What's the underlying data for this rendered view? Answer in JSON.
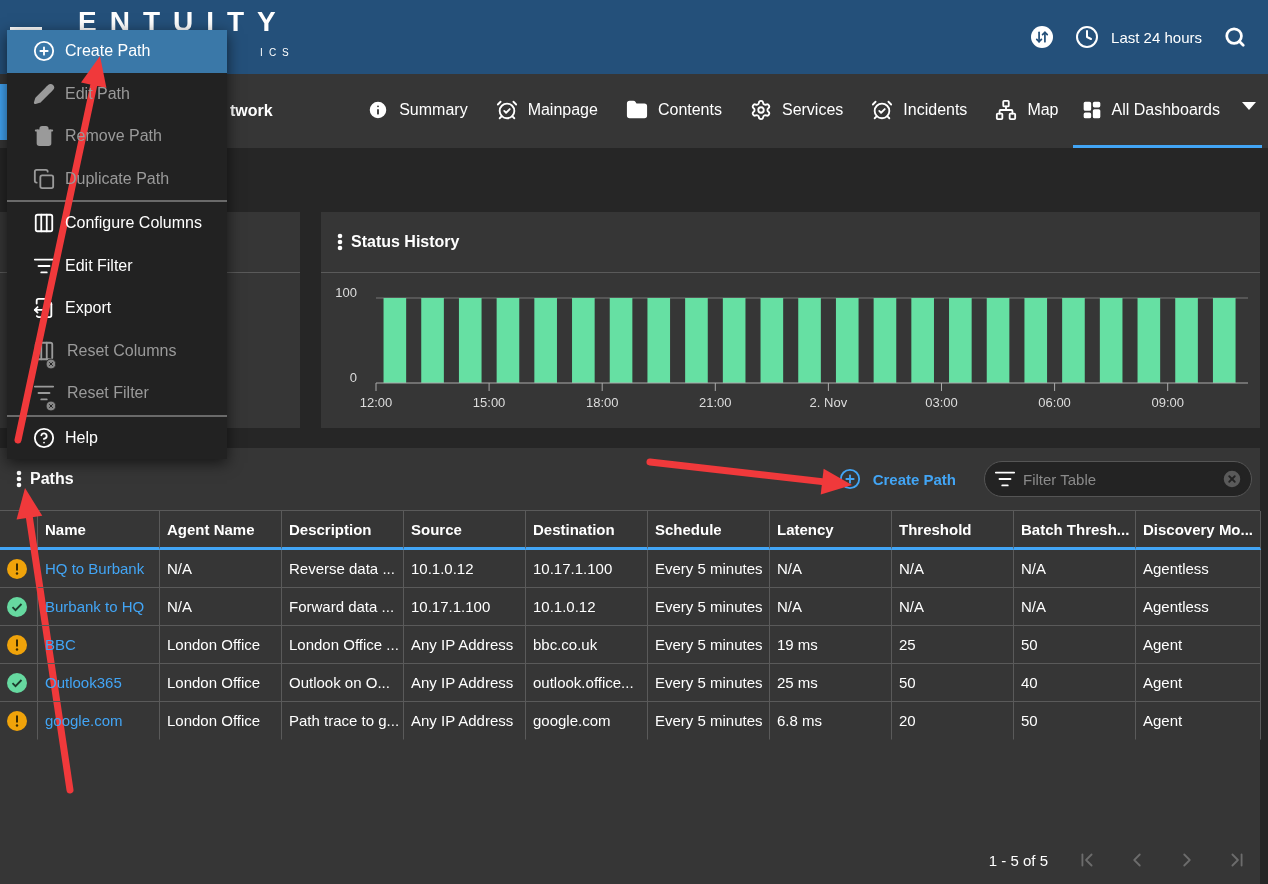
{
  "header": {
    "logo": "ENTUITY",
    "logo_subtitle": "ICS",
    "time_range": "Last 24 hours"
  },
  "nav": {
    "breadcrumb": "twork",
    "tabs": [
      {
        "label": "Summary",
        "selected": false
      },
      {
        "label": "Mainpage",
        "selected": false
      },
      {
        "label": "Contents",
        "selected": false
      },
      {
        "label": "Services",
        "selected": false
      },
      {
        "label": "Incidents",
        "selected": false
      },
      {
        "label": "Map",
        "selected": false
      },
      {
        "label": "All Dashboards",
        "selected": true
      }
    ]
  },
  "menu": {
    "groups": [
      [
        {
          "label": "Create Path",
          "selected": true,
          "disabled": false
        },
        {
          "label": "Edit Path",
          "selected": false,
          "disabled": true
        },
        {
          "label": "Remove Path",
          "selected": false,
          "disabled": true
        },
        {
          "label": "Duplicate Path",
          "selected": false,
          "disabled": true
        }
      ],
      [
        {
          "label": "Configure Columns",
          "selected": false,
          "disabled": false
        },
        {
          "label": "Edit Filter",
          "selected": false,
          "disabled": false
        },
        {
          "label": "Export",
          "selected": false,
          "disabled": false
        },
        {
          "label": "Reset Columns",
          "selected": false,
          "disabled": true
        },
        {
          "label": "Reset Filter",
          "selected": false,
          "disabled": true
        }
      ],
      [
        {
          "label": "Help",
          "selected": false,
          "disabled": false
        }
      ]
    ]
  },
  "status_history": {
    "title": "Status History",
    "chart_data": {
      "type": "bar",
      "categories": [
        "12:00",
        null,
        null,
        "15:00",
        null,
        null,
        "18:00",
        null,
        null,
        "21:00",
        null,
        null,
        "2. Nov",
        null,
        null,
        "03:00",
        null,
        null,
        "06:00",
        null,
        null,
        "09:00",
        null
      ],
      "values": [
        100,
        100,
        100,
        100,
        100,
        100,
        100,
        100,
        100,
        100,
        100,
        100,
        100,
        100,
        100,
        100,
        100,
        100,
        100,
        100,
        100,
        100,
        100
      ],
      "ylim": [
        0,
        100
      ],
      "yticks": [
        0,
        100
      ]
    }
  },
  "paths": {
    "title": "Paths",
    "create_button": "Create Path",
    "filter": {
      "placeholder": "Filter Table"
    },
    "columns": [
      "Name",
      "Agent Name",
      "Description",
      "Source",
      "Destination",
      "Schedule",
      "Latency",
      "Threshold",
      "Batch Thresh...",
      "Discovery Mo..."
    ],
    "rows": [
      {
        "kind": "warning",
        "cells": [
          "HQ to Burbank",
          "N/A",
          "Reverse data ...",
          "10.1.0.12",
          "10.17.1.100",
          "Every 5 minutes",
          "N/A",
          "N/A",
          "N/A",
          "Agentless"
        ]
      },
      {
        "kind": "ok",
        "cells": [
          "Burbank to HQ",
          "N/A",
          "Forward data ...",
          "10.17.1.100",
          "10.1.0.12",
          "Every 5 minutes",
          "N/A",
          "N/A",
          "N/A",
          "Agentless"
        ]
      },
      {
        "kind": "warning",
        "cells": [
          "BBC",
          "London Office",
          "London Office ...",
          "Any IP Address",
          "bbc.co.uk",
          "Every 5 minutes",
          "19 ms",
          "25",
          "50",
          "Agent"
        ]
      },
      {
        "kind": "ok",
        "cells": [
          "Outlook365",
          "London Office",
          "Outlook on O...",
          "Any IP Address",
          "outlook.office...",
          "Every 5 minutes",
          "25 ms",
          "50",
          "40",
          "Agent"
        ]
      },
      {
        "kind": "warning",
        "cells": [
          "google.com",
          "London Office",
          "Path trace to g...",
          "Any IP Address",
          "google.com",
          "Every 5 minutes",
          "6.8 ms",
          "20",
          "50",
          "Agent"
        ]
      }
    ],
    "pagination": "1 - 5 of 5"
  }
}
